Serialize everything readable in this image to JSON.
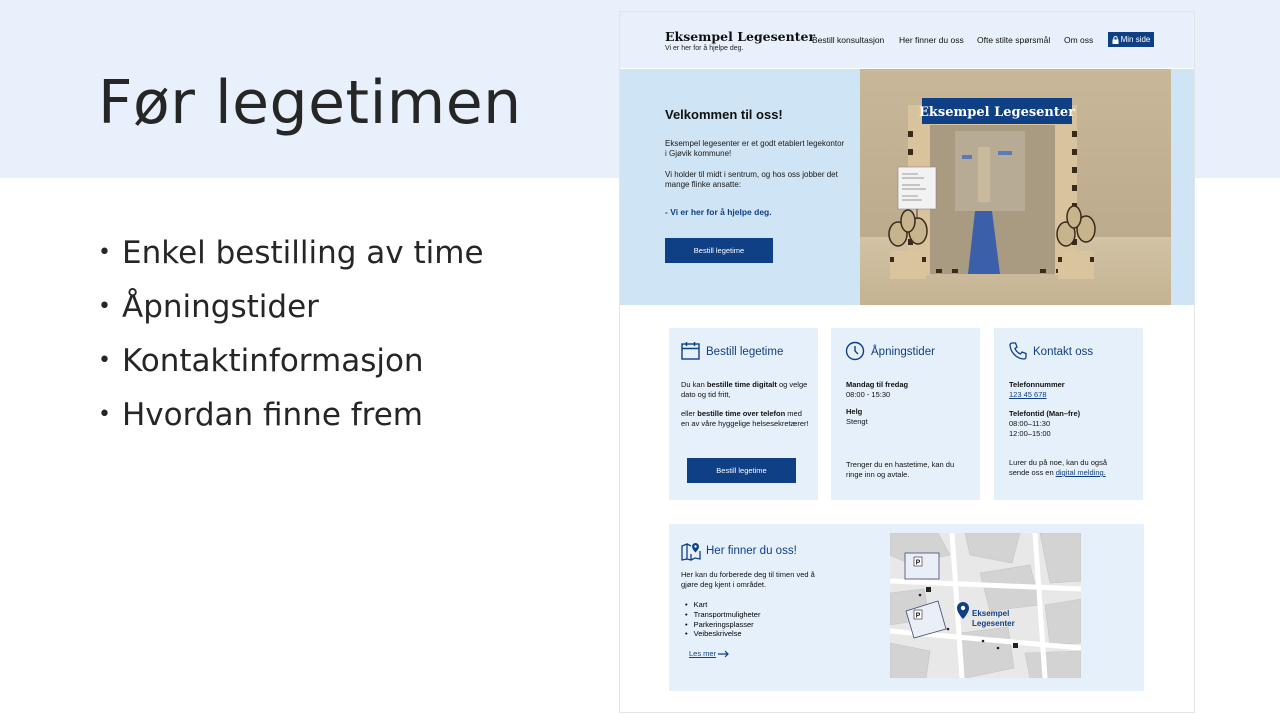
{
  "slide": {
    "title": "Før legetimen",
    "bullets": [
      "Enkel bestilling  av time",
      "Åpningstider",
      "Kontaktinformasjon",
      "Hvordan finne frem"
    ]
  },
  "site": {
    "brand": {
      "name": "Eksempel Legesenter",
      "tagline": "Vi er her for å hjelpe deg."
    },
    "nav": [
      "Bestill konsultasjon",
      "Her finner du oss",
      "Ofte stilte spørsmål",
      "Om oss"
    ],
    "nav_button": "Min side",
    "hero": {
      "title": "Velkommen til oss!",
      "p1": "Eksempel legesenter er et godt etablert legekontor i Gjøvik kommune!",
      "p2": "Vi holder til midt i sentrum, og hos oss jobber det mange flinke ansatte:",
      "slogan": "- Vi er her for å hjelpe deg.",
      "button": "Bestill legetime",
      "sign": "Eksempel Legesenter"
    },
    "booking": {
      "title": "Bestill legetime",
      "p1_a": "Du kan ",
      "p1_b": "bestille time digitalt",
      "p1_c": " og velge dato og tid fritt,",
      "p2_a": "eller ",
      "p2_b": "bestille time over telefon",
      "p2_c": " med en av våre hyggelige helsesekretærer!",
      "button": "Bestill legetime"
    },
    "hours": {
      "title": "Åpningstider",
      "weekday_label": "Mandag til fredag",
      "weekday_hours": "08:00 - 15:30",
      "weekend_label": "Helg",
      "weekend_hours": "Stengt",
      "note": "Trenger du en hastetime, kan du ringe inn og avtale."
    },
    "contact": {
      "title": "Kontakt oss",
      "phone_label": "Telefonnummer",
      "phone": "123 45 678",
      "phone_time_label": "Telefontid (Man–fre)",
      "phone_time_1": "08:00–11:30",
      "phone_time_2": "12:00–15:00",
      "note": "Lurer du på noe, kan du også sende oss en",
      "link": "digital melding."
    },
    "find": {
      "title": "Her finner du oss!",
      "intro": "Her kan du forberede deg til timen ved å gjøre deg kjent i området.",
      "items": [
        "Kart",
        "Transportmuligheter",
        "Parkeringsplasser",
        "Veibeskrivelse"
      ],
      "more": "Les mer",
      "map_label_1": "Eksempel",
      "map_label_2": "Legesenter"
    }
  },
  "colors": {
    "brand": "#0f3f85",
    "band": "#e8f1fb",
    "hero": "#cfe4f4",
    "card": "#e6f0fb"
  }
}
